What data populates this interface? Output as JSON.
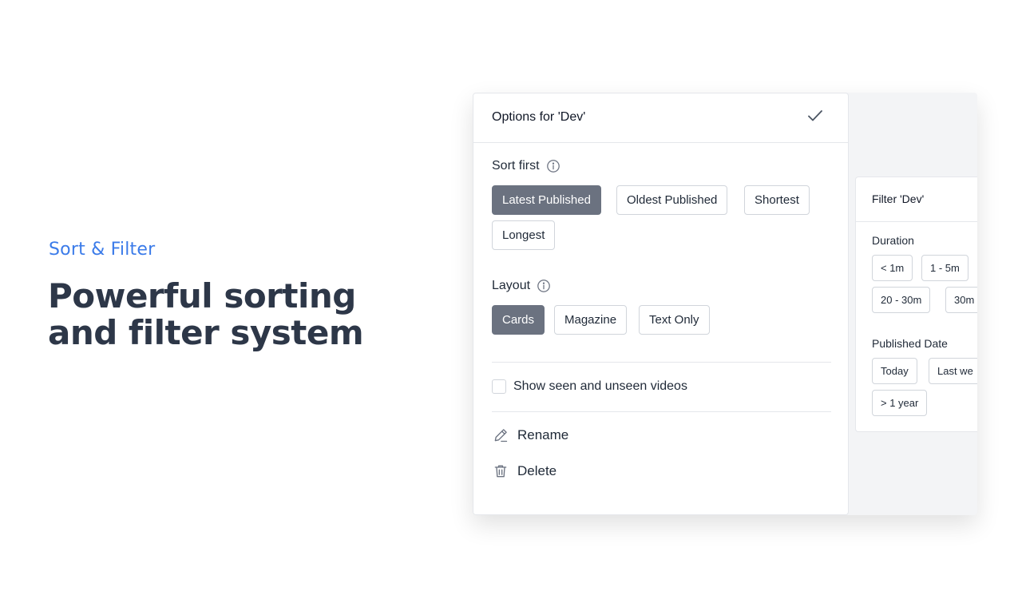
{
  "hero": {
    "eyebrow": "Sort & Filter",
    "title": "Powerful sorting and filter system"
  },
  "options": {
    "title": "Options for 'Dev'",
    "sort_label": "Sort first",
    "sort_options": [
      "Latest Published",
      "Oldest Published",
      "Shortest",
      "Longest"
    ],
    "sort_selected": "Latest Published",
    "layout_label": "Layout",
    "layout_options": [
      "Cards",
      "Magazine",
      "Text Only"
    ],
    "layout_selected": "Cards",
    "seen_label": "Show seen and unseen videos",
    "seen_checked": false,
    "rename_label": "Rename",
    "delete_label": "Delete"
  },
  "filter": {
    "title": "Filter 'Dev'",
    "duration_label": "Duration",
    "duration_options": [
      "< 1m",
      "1 - 5m",
      "20 - 30m",
      "30m"
    ],
    "published_label": "Published Date",
    "published_options": [
      "Today",
      "Last we",
      "> 1 year"
    ]
  },
  "colors": {
    "accent": "#3b7be9",
    "active_chip": "#6b7280",
    "heading": "#2d3748"
  }
}
